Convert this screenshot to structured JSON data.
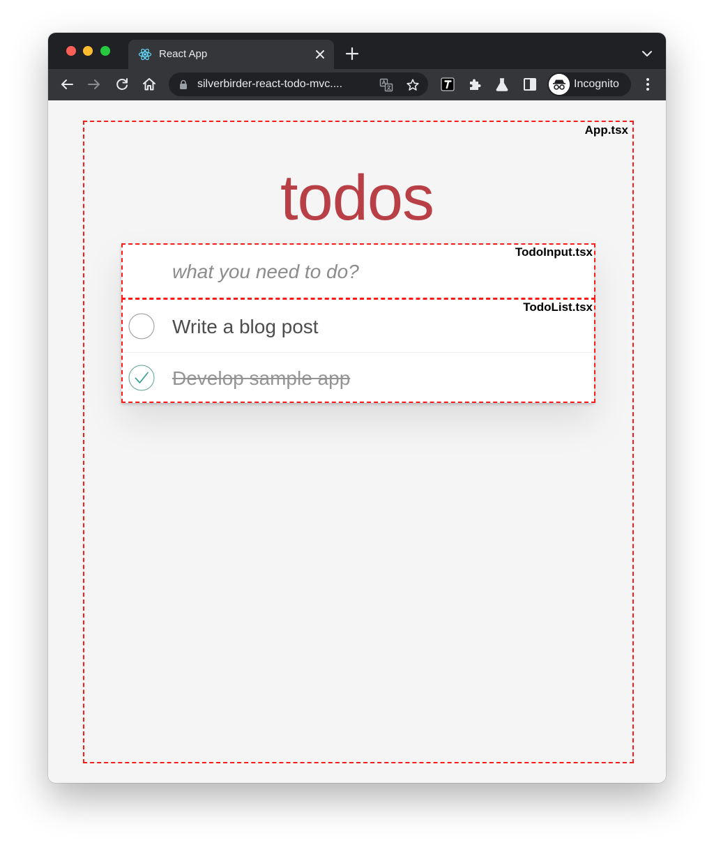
{
  "browser": {
    "tab": {
      "title": "React App",
      "favicon": "react-logo-icon"
    },
    "toolbar": {
      "url": "silverbirder-react-todo-mvc....",
      "profile_label": "Incognito"
    }
  },
  "annotations": {
    "app_label": "App.tsx",
    "input_label": "TodoInput.tsx",
    "list_label": "TodoList.tsx",
    "outline_color": "#ff1a1a"
  },
  "app": {
    "title": "todos",
    "title_color": "#b83f45",
    "new_todo": {
      "placeholder": "what you need to do?",
      "value": ""
    },
    "todos": [
      {
        "text": "Write a blog post",
        "completed": false
      },
      {
        "text": "Develop sample app",
        "completed": true
      }
    ]
  }
}
